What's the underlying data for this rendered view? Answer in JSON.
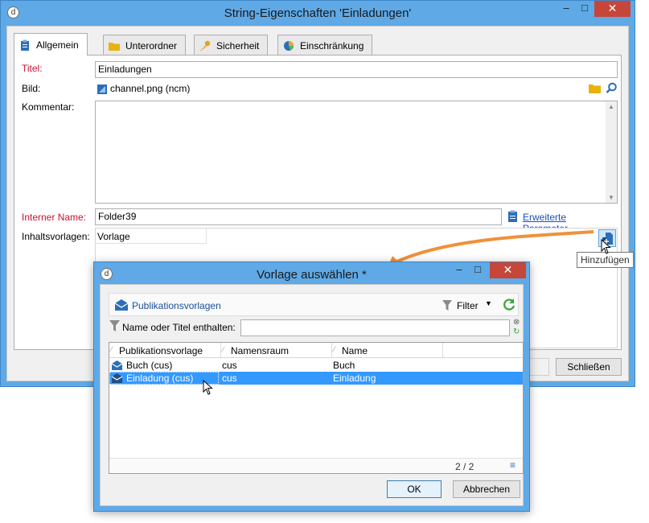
{
  "main_window": {
    "title": "String-Eigenschaften 'Einladungen'",
    "controls": {
      "minimize": "–",
      "maximize": "□",
      "close": "✕"
    },
    "tabs": [
      {
        "label": "Allgemein",
        "icon": "clipboard-icon",
        "active": true
      },
      {
        "label": "Unterordner",
        "icon": "folder-icon",
        "active": false
      },
      {
        "label": "Sicherheit",
        "icon": "key-icon",
        "active": false
      },
      {
        "label": "Einschränkung",
        "icon": "pie-chart-icon",
        "active": false
      }
    ],
    "form": {
      "titel_label": "Titel:",
      "titel_value": "Einladungen",
      "bild_label": "Bild:",
      "bild_value": "channel.png (ncm)",
      "kommentar_label": "Kommentar:",
      "kommentar_value": "",
      "interner_name_label": "Interner Name:",
      "interner_name_value": "Folder39",
      "erweiterte_link": "Erweiterte Parameter...",
      "inhaltsvorlagen_label": "Inhaltsvorlagen:",
      "inhaltsvorlagen_column": "Vorlage"
    },
    "tooltip": "Hinzufügen",
    "close_button": "Schließen"
  },
  "dialog": {
    "title": "Vorlage auswählen *",
    "controls": {
      "minimize": "–",
      "maximize": "□",
      "close": "✕"
    },
    "toolbar": {
      "folder_label": "Publikationsvorlagen",
      "filter_label": "Filter"
    },
    "search": {
      "label": "Name oder Titel enthalten:",
      "value": ""
    },
    "table": {
      "columns": [
        "Publikationsvorlage",
        "Namensraum",
        "Name"
      ],
      "rows": [
        {
          "template": "Buch (cus)",
          "namespace": "cus",
          "name": "Buch",
          "selected": false
        },
        {
          "template": "Einladung (cus)",
          "namespace": "cus",
          "name": "Einladung",
          "selected": true
        }
      ],
      "counter": "2 / 2"
    },
    "ok_button": "OK",
    "cancel_button": "Abbrechen"
  },
  "colors": {
    "window_frame": "#5fa9e6",
    "close_button": "#c7463a",
    "required_label": "#c8102e",
    "selection": "#3399ff",
    "arrow": "#f0913a",
    "link": "#1a4fbf"
  }
}
